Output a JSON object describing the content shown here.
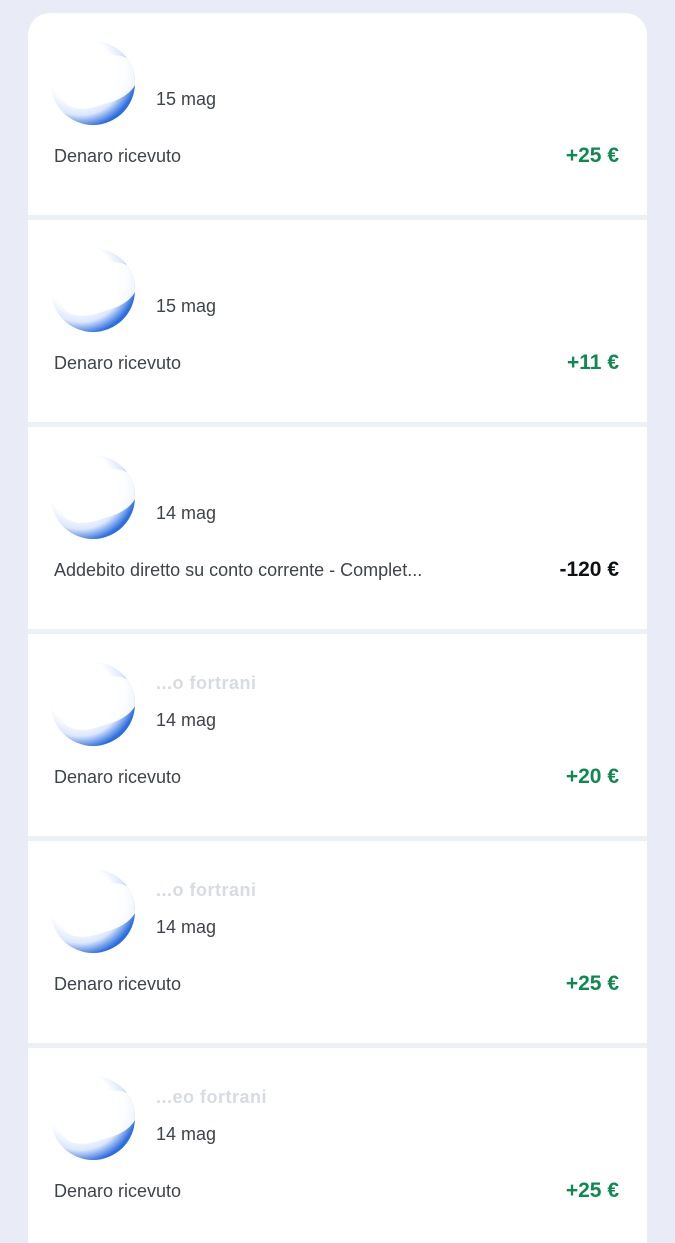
{
  "transactions": [
    {
      "name": "",
      "date": "15 mag",
      "description": "Denaro ricevuto",
      "amount": "+25 €",
      "direction": "incoming"
    },
    {
      "name": "",
      "date": "15 mag",
      "description": "Denaro ricevuto",
      "amount": "+11 €",
      "direction": "incoming"
    },
    {
      "name": "",
      "date": "14 mag",
      "description": "Addebito diretto su conto corrente - Complet...",
      "amount": "-120 €",
      "direction": "outgoing"
    },
    {
      "name": "...o fortrani",
      "date": "14 mag",
      "description": "Denaro ricevuto",
      "amount": "+20 €",
      "direction": "incoming"
    },
    {
      "name": "...o fortrani",
      "date": "14 mag",
      "description": "Denaro ricevuto",
      "amount": "+25 €",
      "direction": "incoming"
    },
    {
      "name": "...eo fortrani",
      "date": "14 mag",
      "description": "Denaro ricevuto",
      "amount": "+25 €",
      "direction": "incoming"
    }
  ],
  "colors": {
    "background": "#e9ecf6",
    "card": "#ffffff",
    "positive_amount": "#0e8a4f",
    "negative_amount": "#0f1115",
    "avatar_accent": "#0a5be0"
  }
}
